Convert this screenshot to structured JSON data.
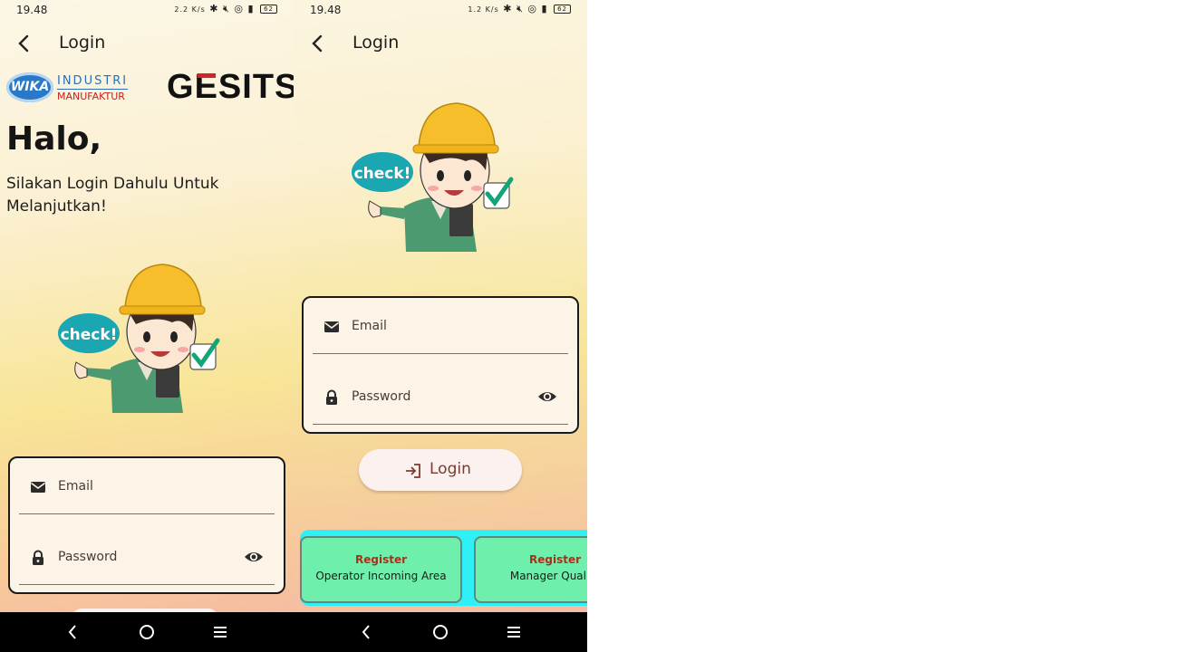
{
  "screens": [
    {
      "status": {
        "time": "19.48",
        "net_speed": "2.2 K/s",
        "battery": "62"
      },
      "appbar": {
        "title": "Login"
      },
      "logos": {
        "wika": "WIKA",
        "industri": "INDUSTRI",
        "manufaktur": "MANUFAKTUR",
        "gesits_g": "G",
        "gesits_e": "E",
        "gesits_rest": "SITS"
      },
      "greeting": {
        "title": "Halo,",
        "subtitle": "Silakan Login Dahulu Untuk Melanjutkan!"
      },
      "illustration": {
        "bubble": "check!"
      },
      "form": {
        "email_label": "Email",
        "password_label": "Password"
      }
    },
    {
      "status": {
        "time": "19.48",
        "net_speed": "1.2 K/s",
        "battery": "62"
      },
      "appbar": {
        "title": "Login"
      },
      "illustration": {
        "bubble": "check!"
      },
      "form": {
        "email_label": "Email",
        "password_label": "Password"
      },
      "login_button": {
        "label": "Login"
      },
      "register": [
        {
          "title": "Register",
          "name": "Operator Incoming Area"
        },
        {
          "title": "Register",
          "name": "Manager Quality"
        }
      ]
    }
  ],
  "icons": {
    "back": "arrow-back-icon",
    "email": "mail-icon",
    "password": "lock-icon",
    "visibility": "eye-icon",
    "login": "login-icon",
    "nav_back": "nav-back-icon",
    "nav_home": "nav-home-icon",
    "nav_menu": "nav-menu-icon"
  },
  "colors": {
    "accent_text": "#7a3b2e",
    "register_strip": "#2ff0f4",
    "register_card": "#6ef0ac",
    "register_title": "#a4331e"
  }
}
